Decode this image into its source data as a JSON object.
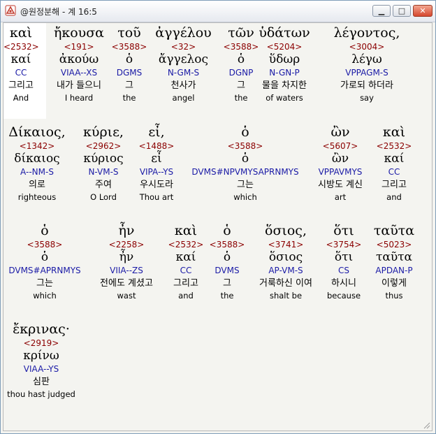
{
  "window": {
    "title": "@원정분해 - 계 16:5",
    "icon": "app-icon",
    "buttons": [
      "minimize",
      "maximize",
      "close"
    ]
  },
  "rows": [
    [
      {
        "greek": "καὶ",
        "num": "<2532>",
        "lemma": "καί",
        "morph": "CC",
        "kor": "그리고",
        "eng": "And"
      },
      {
        "greek": "ἤκουσα",
        "num": "<191>",
        "lemma": "ἀκούω",
        "morph": "VIAA--XS",
        "kor": "내가 들으니",
        "eng": "I heard"
      },
      {
        "greek": "τοῦ",
        "num": "<3588>",
        "lemma": "ὁ",
        "morph": "DGMS",
        "kor": "그",
        "eng": "the"
      },
      {
        "greek": "ἀγγέλου",
        "num": "<32>",
        "lemma": "ἄγγελος",
        "morph": "N-GM-S",
        "kor": "천사가",
        "eng": "angel"
      },
      {
        "greek": "τῶν",
        "num": "<3588>",
        "lemma": "ὁ",
        "morph": "DGNP",
        "kor": "그",
        "eng": "the"
      },
      {
        "greek": "ὑδάτων",
        "num": "<5204>",
        "lemma": "ὕδωρ",
        "morph": "N-GN-P",
        "kor": "물을 차지한",
        "eng": "of waters"
      },
      {
        "greek": "λέγοντος,",
        "num": "<3004>",
        "lemma": "λέγω",
        "morph": "VPPAGM-S",
        "kor": "가로되 하더라",
        "eng": "say"
      }
    ],
    [
      {
        "greek": "Δίκαιος,",
        "num": "<1342>",
        "lemma": "δίκαιος",
        "morph": "A--NM-S",
        "kor": "의로",
        "eng": "righteous"
      },
      {
        "greek": "κύριε,",
        "num": "<2962>",
        "lemma": "κύριος",
        "morph": "N-VM-S",
        "kor": "주여",
        "eng": "O Lord"
      },
      {
        "greek": "εἶ,",
        "num": "<1488>",
        "lemma": "εἶ",
        "morph": "VIPA--YS",
        "kor": "우시도라",
        "eng": "Thou art"
      },
      {
        "greek": "ὁ",
        "num": "<3588>",
        "lemma": "ὁ",
        "morph": "DVMS#NPVMYSAPRNMYS",
        "kor": "그는",
        "eng": "which"
      },
      {
        "greek": "ὢν",
        "num": "<5607>",
        "lemma": "ὢν",
        "morph": "VPPAVMYS",
        "kor": "시방도 계신",
        "eng": "art"
      },
      {
        "greek": "καὶ",
        "num": "<2532>",
        "lemma": "καί",
        "morph": "CC",
        "kor": "그리고",
        "eng": "and"
      }
    ],
    [
      {
        "greek": "ὁ",
        "num": "<3588>",
        "lemma": "ὁ",
        "morph": "DVMS#APRNMYS",
        "kor": "그는",
        "eng": "which"
      },
      {
        "greek": "ἦν",
        "num": "<2258>",
        "lemma": "ἦν",
        "morph": "VIIA--ZS",
        "kor": "전에도 계셨고",
        "eng": "wast"
      },
      {
        "greek": "καὶ",
        "num": "<2532>",
        "lemma": "καί",
        "morph": "CC",
        "kor": "그리고",
        "eng": "and"
      },
      {
        "greek": "ὁ",
        "num": "<3588>",
        "lemma": "ὁ",
        "morph": "DVMS",
        "kor": "그",
        "eng": "the"
      },
      {
        "greek": "ὅσιος,",
        "num": "<3741>",
        "lemma": "ὅσιος",
        "morph": "AP-VM-S",
        "kor": "거룩하신 이여",
        "eng": "shalt be"
      },
      {
        "greek": "ὅτι",
        "num": "<3754>",
        "lemma": "ὅτι",
        "morph": "CS",
        "kor": "하시니",
        "eng": "because"
      },
      {
        "greek": "ταῦτα",
        "num": "<5023>",
        "lemma": "ταῦτα",
        "morph": "APDAN-P",
        "kor": "이렇게",
        "eng": "thus"
      }
    ],
    [
      {
        "greek": "ἔκρινας·",
        "num": "<2919>",
        "lemma": "κρίνω",
        "morph": "VIAA--YS",
        "kor": "심판",
        "eng": "thou hast judged"
      }
    ]
  ]
}
